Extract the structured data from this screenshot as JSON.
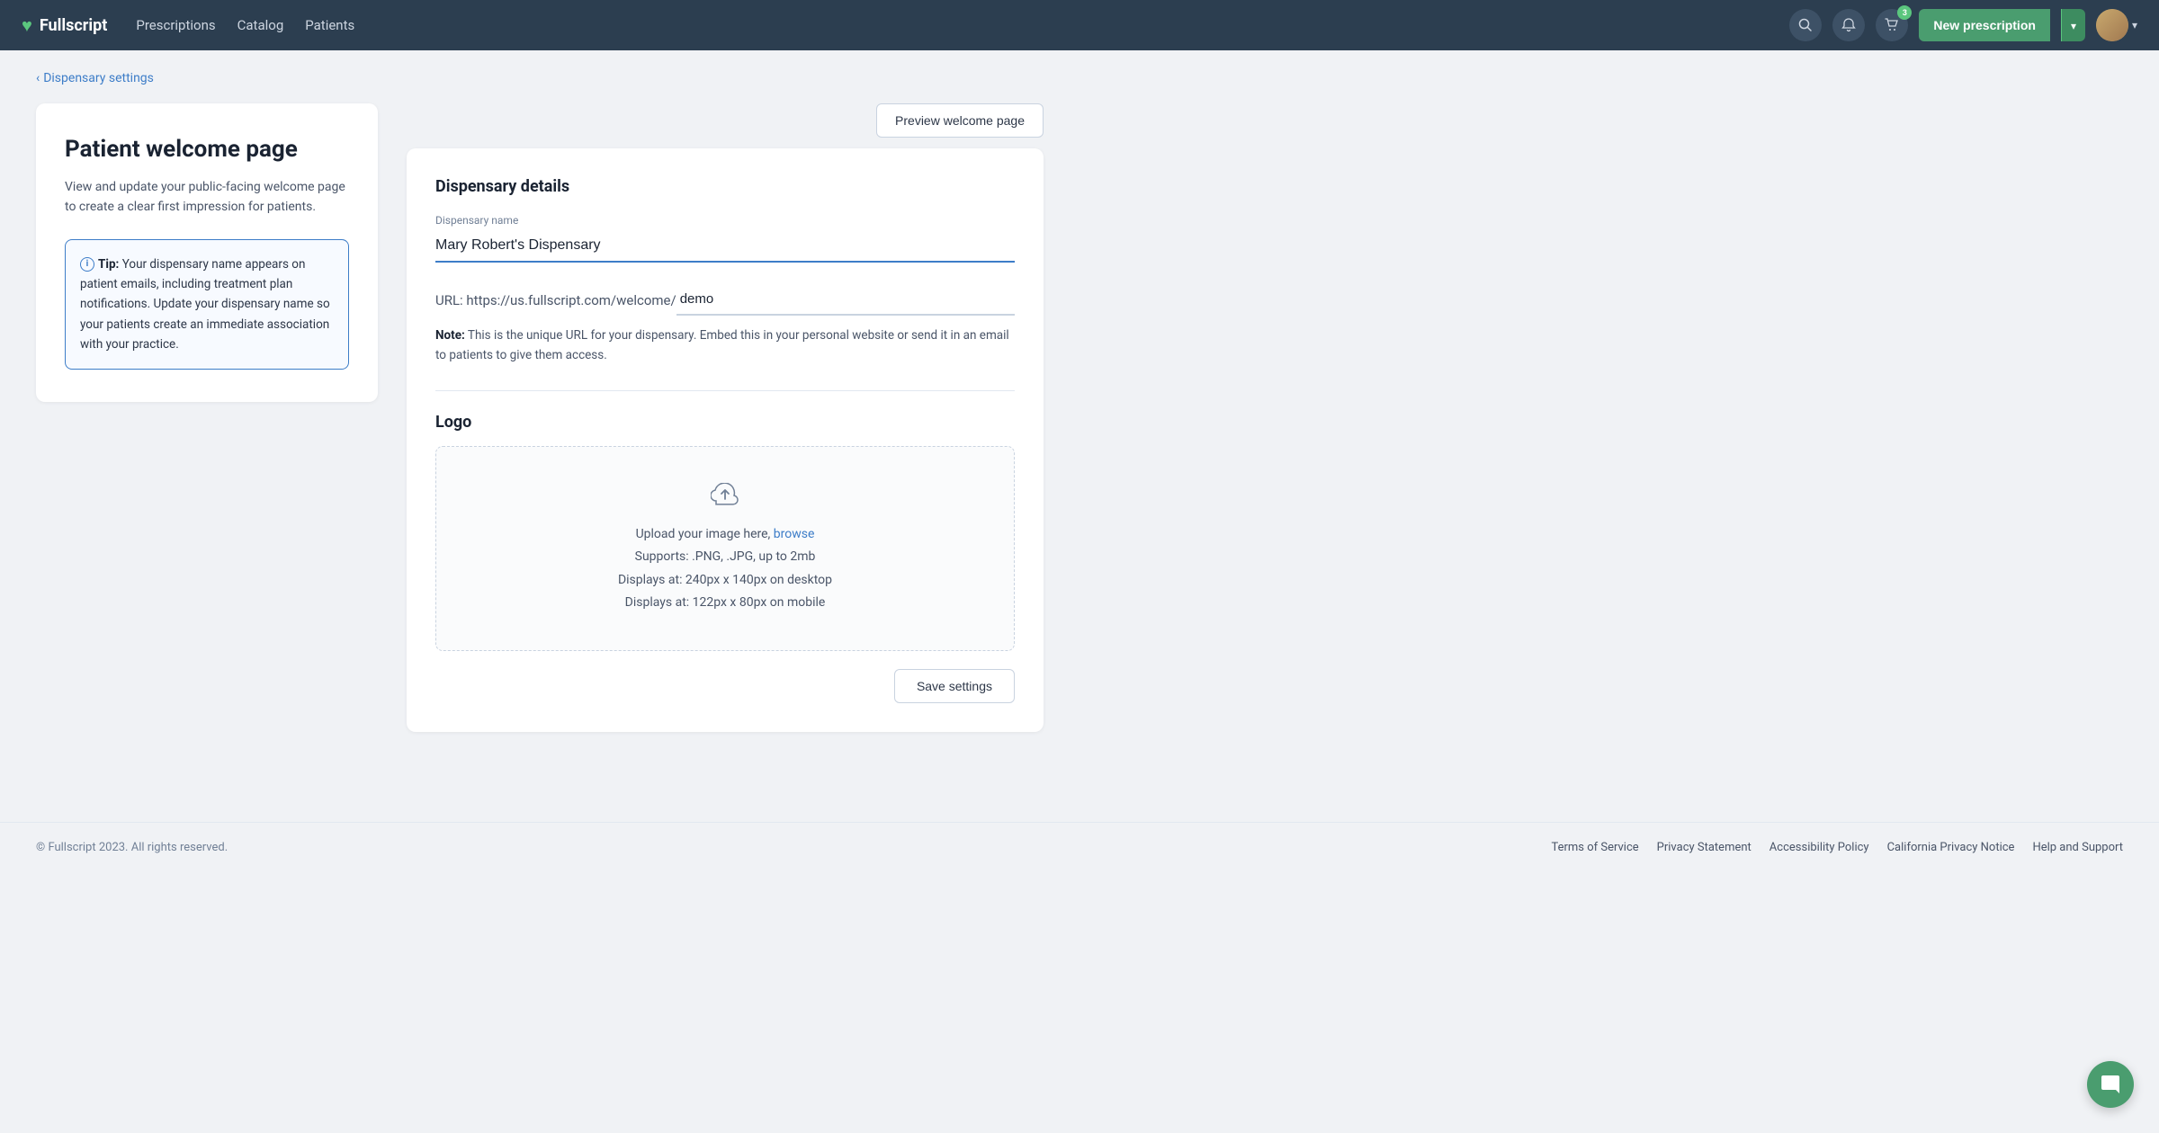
{
  "brand": {
    "name": "Fullscript",
    "heart": "♥"
  },
  "nav": {
    "links": [
      "Prescriptions",
      "Catalog",
      "Patients"
    ],
    "cart_count": "3",
    "new_prescription_label": "New prescription"
  },
  "breadcrumb": {
    "back_label": "Dispensary settings",
    "back_arrow": "‹"
  },
  "left_panel": {
    "title": "Patient welcome page",
    "description": "View and update your public-facing welcome page to create a clear first impression for patients.",
    "tip_icon": "i",
    "tip_text_bold": "Tip:",
    "tip_text": " Your dispensary name appears on patient emails, including treatment plan notifications. Update your dispensary name so your patients create an immediate association with your practice."
  },
  "preview_button": {
    "label": "Preview welcome page"
  },
  "dispensary_details": {
    "section_title": "Dispensary details",
    "dispensary_name_label": "Dispensary name",
    "dispensary_name_value": "Mary Robert's Dispensary",
    "url_prefix": "URL: https://us.fullscript.com/welcome/",
    "url_slug": "demo",
    "note_bold": "Note:",
    "note_text": " This is the unique URL for your dispensary. Embed this in your personal website or send it in an email to patients to give them access."
  },
  "logo_section": {
    "title": "Logo",
    "upload_text": "Upload your image here,",
    "upload_link_text": "browse",
    "supports_text": "Supports: .PNG, .JPG, up to 2mb",
    "desktop_display": "Displays at: 240px x 140px on desktop",
    "mobile_display": "Displays at: 122px x 80px on mobile"
  },
  "save_button": {
    "label": "Save settings"
  },
  "footer": {
    "copyright": "© Fullscript 2023. All rights reserved.",
    "links": [
      "Terms of Service",
      "Privacy Statement",
      "Accessibility Policy",
      "California Privacy Notice",
      "Help and Support"
    ]
  }
}
